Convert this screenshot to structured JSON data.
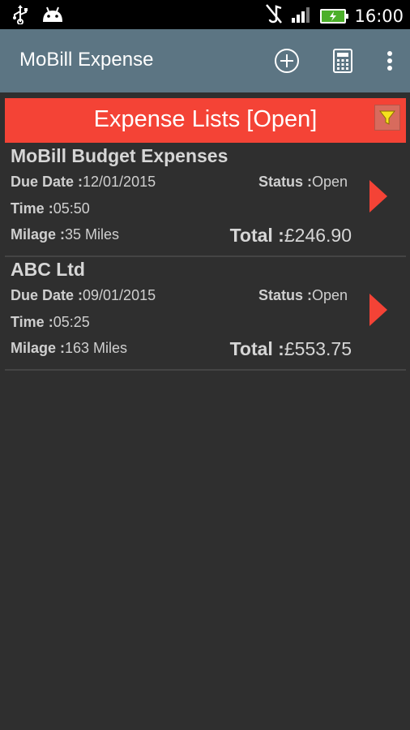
{
  "status_bar": {
    "time": "16:00",
    "icons": [
      "usb-icon",
      "android-icon",
      "mute-icon",
      "signal-icon",
      "battery-icon"
    ]
  },
  "action_bar": {
    "title": "MoBill Expense",
    "icons": [
      "add-circle-icon",
      "calculator-icon",
      "overflow-menu-icon"
    ]
  },
  "header": {
    "title": "Expense Lists [Open]",
    "filter_icon": "filter-icon",
    "accent_color": "#f44336"
  },
  "expenses": [
    {
      "name": "MoBill Budget Expenses",
      "due_date_label": "Due Date :",
      "due_date": "12/01/2015",
      "status_label": "Status :",
      "status": "Open",
      "time_label": "Time :",
      "time": "05:50",
      "milage_label": "Milage :",
      "milage": "35 Miles",
      "total_label": "Total :",
      "total": "£246.90"
    },
    {
      "name": "ABC Ltd",
      "due_date_label": "Due Date :",
      "due_date": "09/01/2015",
      "status_label": "Status :",
      "status": "Open",
      "time_label": "Time :",
      "time": "05:25",
      "milage_label": "Milage :",
      "milage": "163 Miles",
      "total_label": "Total :",
      "total": "£553.75"
    }
  ]
}
